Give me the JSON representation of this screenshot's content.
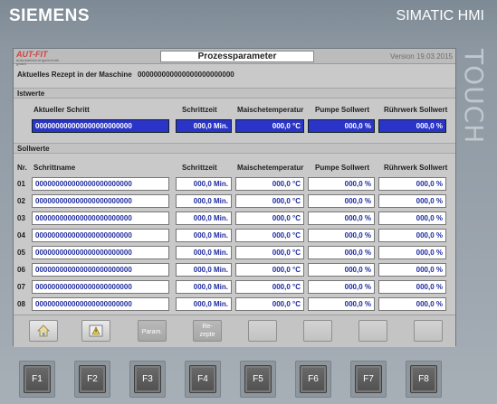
{
  "device": {
    "brand": "SIEMENS",
    "model": "SIMATIC HMI",
    "side_label": "TOUCH"
  },
  "screen": {
    "logo": "AUT-FIT",
    "logo_sub": "automatisierungstechnik gmbh",
    "title": "Prozessparameter",
    "version": "Version 19.03.2015",
    "recipe_label": "Aktuelles Rezept in der Maschine",
    "recipe_value": "000000000000000000000000"
  },
  "istwerte": {
    "section": "Istwerte",
    "headers": {
      "step": "Aktueller Schritt",
      "time": "Schrittzeit",
      "temp": "Maischetemperatur",
      "pump": "Pumpe Sollwert",
      "stir": "Rührwerk Sollwert"
    },
    "row": {
      "step": "000000000000000000000000",
      "time": "000,0 Min.",
      "temp": "000,0 °C",
      "pump": "000,0 %",
      "stir": "000,0 %"
    }
  },
  "sollwerte": {
    "section": "Sollwerte",
    "headers": {
      "nr": "Nr.",
      "name": "Schrittname",
      "time": "Schrittzeit",
      "temp": "Maischetemperatur",
      "pump": "Pumpe Sollwert",
      "stir": "Rührwerk Sollwert"
    },
    "rows": [
      {
        "nr": "01",
        "name": "000000000000000000000000",
        "time": "000,0 Min.",
        "temp": "000,0 °C",
        "pump": "000,0 %",
        "stir": "000,0 %"
      },
      {
        "nr": "02",
        "name": "000000000000000000000000",
        "time": "000,0 Min.",
        "temp": "000,0 °C",
        "pump": "000,0 %",
        "stir": "000,0 %"
      },
      {
        "nr": "03",
        "name": "000000000000000000000000",
        "time": "000,0 Min.",
        "temp": "000,0 °C",
        "pump": "000,0 %",
        "stir": "000,0 %"
      },
      {
        "nr": "04",
        "name": "000000000000000000000000",
        "time": "000,0 Min.",
        "temp": "000,0 °C",
        "pump": "000,0 %",
        "stir": "000,0 %"
      },
      {
        "nr": "05",
        "name": "000000000000000000000000",
        "time": "000,0 Min.",
        "temp": "000,0 °C",
        "pump": "000,0 %",
        "stir": "000,0 %"
      },
      {
        "nr": "06",
        "name": "000000000000000000000000",
        "time": "000,0 Min.",
        "temp": "000,0 °C",
        "pump": "000,0 %",
        "stir": "000,0 %"
      },
      {
        "nr": "07",
        "name": "000000000000000000000000",
        "time": "000,0 Min.",
        "temp": "000,0 °C",
        "pump": "000,0 %",
        "stir": "000,0 %"
      },
      {
        "nr": "08",
        "name": "000000000000000000000000",
        "time": "000,0 Min.",
        "temp": "000,0 °C",
        "pump": "000,0 %",
        "stir": "000,0 %"
      }
    ]
  },
  "navbar": {
    "home_icon": "home-icon",
    "warning_icon": "warning-icon",
    "param_label": "Param.",
    "rezepte_label_1": "Re-",
    "rezepte_label_2": "zepte"
  },
  "function_keys": [
    "F1",
    "F2",
    "F3",
    "F4",
    "F5",
    "F6",
    "F7",
    "F8"
  ],
  "colors": {
    "active_field": "#2a34c8",
    "value_text": "#1d2a9e",
    "brand": "#ffffff"
  }
}
